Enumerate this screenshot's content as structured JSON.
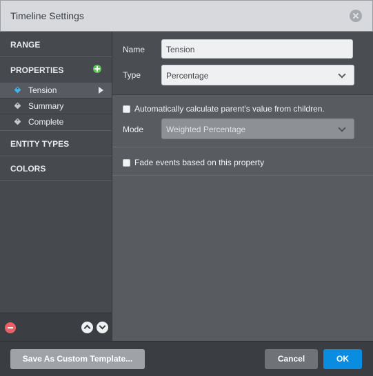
{
  "dialog": {
    "title": "Timeline Settings",
    "close_icon": "close-icon"
  },
  "sidebar": {
    "sections": [
      {
        "label": "RANGE"
      },
      {
        "label": "PROPERTIES"
      },
      {
        "label": "ENTITY TYPES"
      },
      {
        "label": "COLORS"
      }
    ],
    "properties": [
      {
        "label": "Tension",
        "tag_color": "#3fb3ea",
        "selected": true
      },
      {
        "label": "Summary",
        "tag_color": "#c4c7cb",
        "selected": false
      },
      {
        "label": "Complete",
        "tag_color": "#c4c7cb",
        "selected": false
      }
    ],
    "icons": {
      "add": "add-icon",
      "remove": "remove-icon",
      "move_up": "move-up-icon",
      "move_down": "move-down-icon"
    }
  },
  "form": {
    "name_label": "Name",
    "name_value": "Tension",
    "type_label": "Type",
    "type_value": "Percentage",
    "auto_calc_label": "Automatically calculate parent's value from children.",
    "auto_calc_checked": false,
    "mode_label": "Mode",
    "mode_value": "Weighted Percentage",
    "fade_label": "Fade events based on this property",
    "fade_checked": false
  },
  "footer": {
    "save_template_label": "Save As Custom Template...",
    "cancel_label": "Cancel",
    "ok_label": "OK"
  },
  "colors": {
    "accent": "#0a8de0",
    "add": "#5ec45a",
    "remove": "#e86168"
  }
}
